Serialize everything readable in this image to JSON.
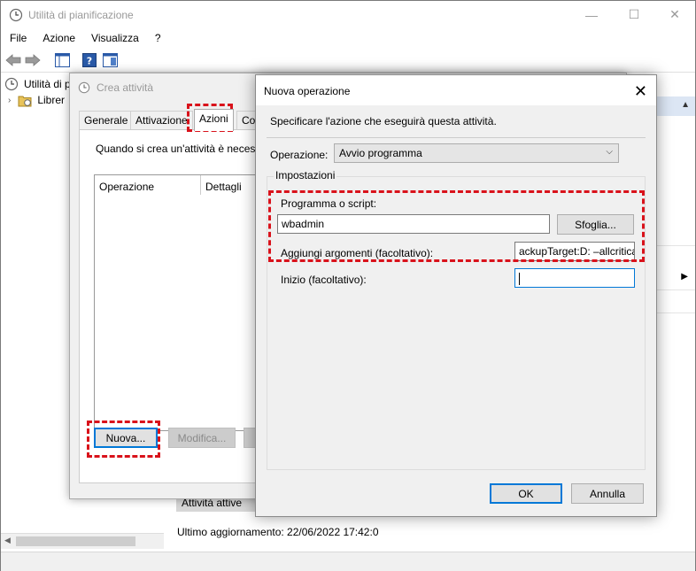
{
  "window": {
    "title": "Utilità di pianificazione",
    "minimize": "—",
    "maximize": "☐",
    "close": "✕"
  },
  "menu": [
    "File",
    "Azione",
    "Visualizza",
    "?"
  ],
  "tree": {
    "root_label": "Utilità di p",
    "child_label": "Librer"
  },
  "crea": {
    "title": "Crea attività",
    "tabs": [
      "Generale",
      "Attivazione",
      "Azioni",
      "Co"
    ],
    "active_tab": "Azioni",
    "hint": "Quando si crea un'attività è necess",
    "columns": [
      "Operazione",
      "Dettagli"
    ],
    "btn_new": "Nuova...",
    "btn_edit": "Modifica..."
  },
  "background": {
    "active_tasks_header": "Attività attive",
    "last_update": "Ultimo aggiornamento: 22/06/2022 17:42:0"
  },
  "nuova": {
    "title": "Nuova operazione",
    "description": "Specificare l'azione che eseguirà questa attività.",
    "operation_label": "Operazione:",
    "operation_value": "Avvio programma",
    "settings_legend": "Impostazioni",
    "program_label": "Programma o script:",
    "program_value": "wbadmin",
    "browse_label": "Sfoglia...",
    "args_label": "Aggiungi argomenti (facoltativo):",
    "args_value": "ackupTarget:D: –allcritica",
    "start_label": "Inizio (facoltativo):",
    "start_value": "",
    "ok_label": "OK",
    "cancel_label": "Annulla"
  },
  "colors": {
    "highlight": "#d9121b",
    "accent": "#0078d7"
  }
}
